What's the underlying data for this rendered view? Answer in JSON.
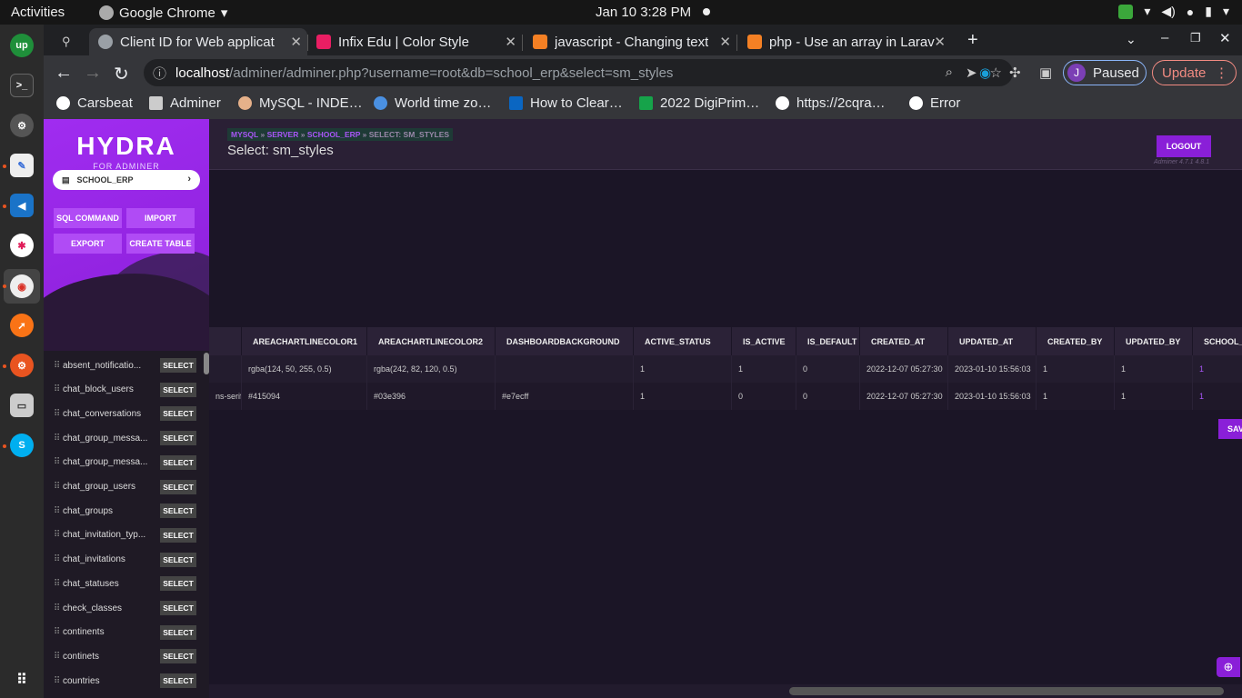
{
  "os": {
    "activities": "Activities",
    "app_name": "Google Chrome",
    "clock": "Jan 10  3:28 PM"
  },
  "tabs": [
    {
      "label": "Client ID for Web applicat",
      "color": "#9aa0a6"
    },
    {
      "label": "Infix Edu | Color Style",
      "color": "#e91e63"
    },
    {
      "label": "javascript - Changing text",
      "color": "#f48024"
    },
    {
      "label": "php - Use an array in Larav",
      "color": "#f48024"
    }
  ],
  "toolbar": {
    "url_host": "localhost",
    "url_path": "/adminer/adminer.php?username=root&db=school_erp&select=sm_styles",
    "profile_initial": "J",
    "paused_label": "Paused",
    "update_label": "Update"
  },
  "bookmarks": [
    "Carsbeat",
    "Adminer",
    "MySQL - INDE…",
    "World time zo…",
    "How to Clear…",
    "2022 DigiPrim…",
    "https://2cqra…",
    "Error"
  ],
  "sidebar": {
    "logo": "HYDRA",
    "logo_sub": "FOR ADMINER",
    "db": "SCHOOL_ERP",
    "buttons": {
      "sql": "SQL COMMAND",
      "import": "IMPORT",
      "export": "EXPORT",
      "create": "CREATE TABLE"
    },
    "select_label": "SELECT",
    "tables": [
      "absent_notificatio...",
      "chat_block_users",
      "chat_conversations",
      "chat_group_messa...",
      "chat_group_messa...",
      "chat_group_users",
      "chat_groups",
      "chat_invitation_typ...",
      "chat_invitations",
      "chat_statuses",
      "check_classes",
      "continents",
      "continets",
      "countries"
    ]
  },
  "header": {
    "crumb_mysql": "MYSQL",
    "crumb_server": "SERVER",
    "crumb_db": "SCHOOL_ERP",
    "crumb_current": "SELECT: SM_STYLES",
    "sep": "»",
    "title": "Select: sm_styles",
    "logout": "LOGOUT",
    "version": "Adminer 4.7.1 4.8.1"
  },
  "grid": {
    "columns": [
      "",
      "AREACHARTLINECOLOR1",
      "AREACHARTLINECOLOR2",
      "DASHBOARDBACKGROUND",
      "ACTIVE_STATUS",
      "IS_ACTIVE",
      "IS_DEFAULT",
      "CREATED_AT",
      "UPDATED_AT",
      "CREATED_BY",
      "UPDATED_BY",
      "SCHOOL_I"
    ],
    "rows": [
      [
        "",
        "rgba(124, 50, 255, 0.5)",
        "rgba(242, 82, 120, 0.5)",
        "",
        "1",
        "1",
        "0",
        "2022-12-07 05:27:30",
        "2023-01-10 15:56:03",
        "1",
        "1",
        "1"
      ],
      [
        "ns-serif",
        "#415094",
        "#03e396",
        "#e7ecff",
        "1",
        "0",
        "0",
        "2022-12-07 05:27:30",
        "2023-01-10 15:56:03",
        "1",
        "1",
        "1"
      ]
    ]
  },
  "save_label": "SAV",
  "colors": {
    "accent": "#8a1fd8",
    "sidebar_head": "#a02cf0",
    "bg": "#1b1526"
  }
}
